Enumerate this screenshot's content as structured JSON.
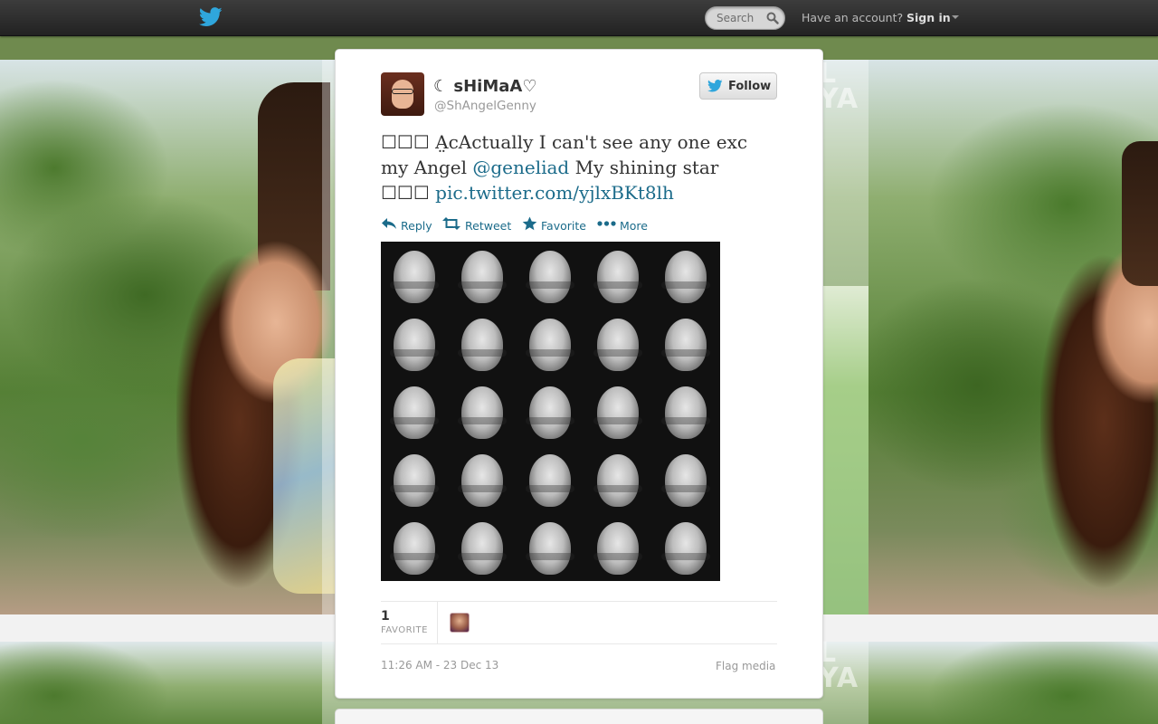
{
  "topbar": {
    "search_placeholder": "Search",
    "have_account": "Have an account?",
    "sign_in": "Sign in"
  },
  "tweet": {
    "display_name": "☾ sHiMaA♡",
    "screen_name": "@ShAngelGenny",
    "follow_label": "Follow",
    "text_part1": "☐☐☐ A̤cActually I can't see any one exc my Angel ",
    "mention": "@geneliad",
    "text_part2": " My shining star ☐☐☐ ",
    "link": "pic.twitter.com/yjlxBKt8lh",
    "actions": {
      "reply": "Reply",
      "retweet": "Retweet",
      "favorite": "Favorite",
      "more": "More"
    },
    "favorite_count": "1",
    "favorite_label": "FAVORITE",
    "timestamp": "11:26 AM - 23 Dec 13",
    "flag_media": "Flag media"
  },
  "background": {
    "watermark_top": "L\nYA"
  },
  "colors": {
    "link": "#1b6b8a",
    "twitter_blue": "#2fa6dc",
    "topbar": "#2b2b2b"
  },
  "icons": [
    "twitter-bird-icon",
    "search-icon",
    "caret-down-icon",
    "reply-icon",
    "retweet-icon",
    "star-icon",
    "more-dots-icon"
  ]
}
